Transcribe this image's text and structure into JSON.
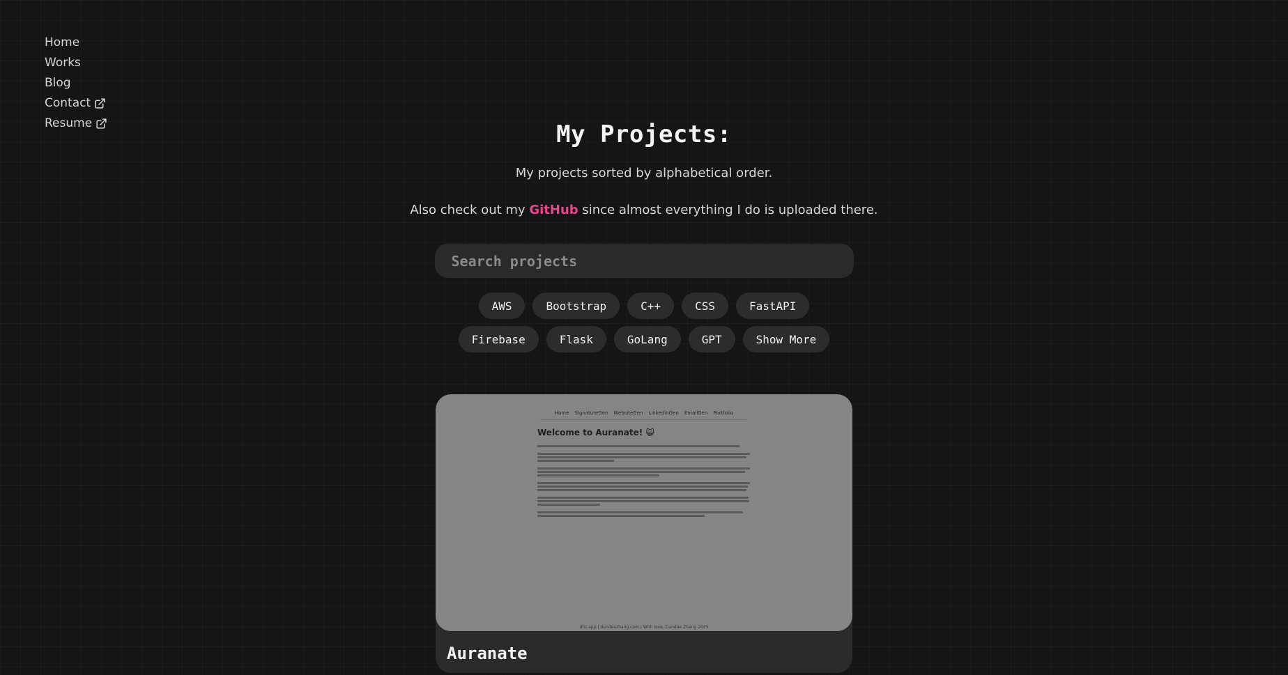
{
  "nav": {
    "items": [
      {
        "label": "Home"
      },
      {
        "label": "Works"
      },
      {
        "label": "Blog"
      },
      {
        "label": "Contact"
      },
      {
        "label": "Resume"
      }
    ]
  },
  "header": {
    "title": "My Projects:",
    "subtitle": "My projects sorted by alphabetical order.",
    "github_prefix": "Also check out my ",
    "github_link": "GitHub",
    "github_suffix": " since almost everything I do is uploaded there."
  },
  "search": {
    "placeholder": "Search projects"
  },
  "tags": {
    "row1": [
      "AWS",
      "Bootstrap",
      "C++",
      "CSS",
      "FastAPI"
    ],
    "row2": [
      "Firebase",
      "Flask",
      "GoLang",
      "GPT"
    ],
    "show_more": "Show More"
  },
  "project": {
    "title": "Auranate",
    "preview": {
      "nav": [
        "Home",
        "SignatureGen",
        "WebsiteGen",
        "LinkedinGen",
        "EmailGen",
        "Portfolio"
      ],
      "heading": "Welcome to Auranate! 😺",
      "footer": "dhz.app | dundeezhang.com | With love, Dundee Zhang 2025"
    }
  },
  "colors": {
    "background": "#151515",
    "accent": "#e8468e",
    "tag_bg": "#2c2c2c"
  }
}
